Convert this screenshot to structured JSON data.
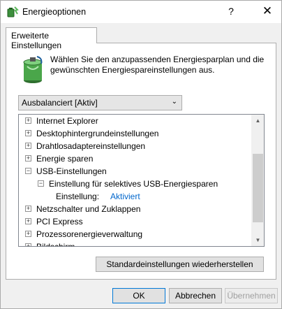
{
  "window": {
    "title": "Energieoptionen",
    "help_glyph": "?",
    "close_glyph": "✕"
  },
  "tab": {
    "label": "Erweiterte Einstellungen"
  },
  "intro": {
    "text": "Wählen Sie den anzupassenden Energiesparplan und die gewünschten Energiespareinstellungen aus."
  },
  "plan_select": {
    "value": "Ausbalanciert [Aktiv]",
    "arrow_glyph": "⌄"
  },
  "tree": {
    "items": [
      {
        "label": "Internet Explorer",
        "expander": "+"
      },
      {
        "label": "Desktophintergrundeinstellungen",
        "expander": "+"
      },
      {
        "label": "Drahtlosadaptereinstellungen",
        "expander": "+"
      },
      {
        "label": "Energie sparen",
        "expander": "+"
      },
      {
        "label": "USB-Einstellungen",
        "expander": "−"
      },
      {
        "label": "Einstellung für selektives USB-Energiesparen",
        "expander": "−"
      },
      {
        "label": "Einstellung:",
        "value": "Aktiviert"
      },
      {
        "label": "Netzschalter und Zuklappen",
        "expander": "+"
      },
      {
        "label": "PCI Express",
        "expander": "+"
      },
      {
        "label": "Prozessorenergieverwaltung",
        "expander": "+"
      },
      {
        "label": "Bildschirm",
        "expander": "+"
      }
    ],
    "scroll_up_glyph": "▲",
    "scroll_down_glyph": "▼"
  },
  "buttons": {
    "restore": "Standardeinstellungen wiederherstellen",
    "ok": "OK",
    "cancel": "Abbrechen",
    "apply": "Übernehmen"
  },
  "colors": {
    "link": "#0066cc",
    "accent_border": "#0078d7"
  }
}
